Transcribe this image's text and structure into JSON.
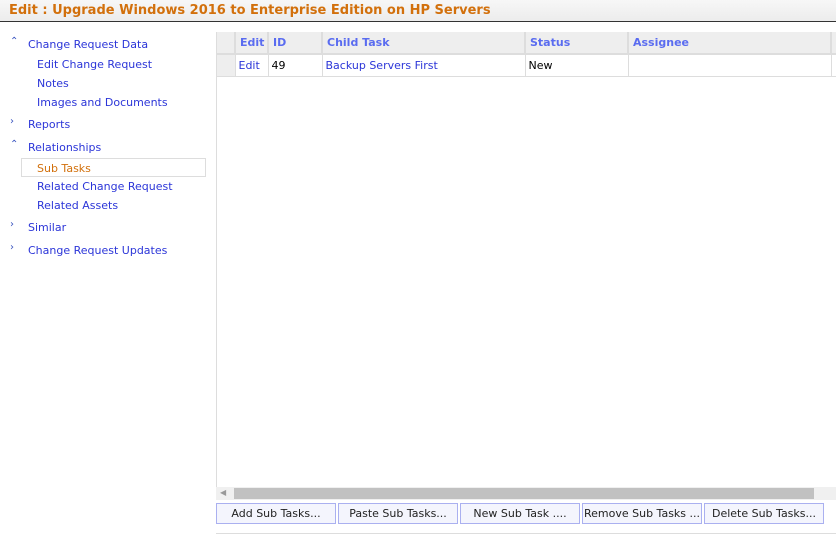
{
  "title": "Edit : Upgrade Windows 2016 to Enterprise Edition on HP Servers",
  "sidebar": {
    "g0": {
      "label": "Change Request Data",
      "icon": "chevron-up-icon",
      "items": [
        "Edit Change Request",
        "Notes",
        "Images and Documents"
      ]
    },
    "g1": {
      "label": "Reports",
      "icon": "chevron-right-icon"
    },
    "g2": {
      "label": "Relationships",
      "icon": "chevron-up-icon",
      "items": [
        "Sub Tasks",
        "Related Change Request",
        "Related Assets"
      ],
      "selected": "Sub Tasks"
    },
    "g3": {
      "label": "Similar",
      "icon": "chevron-right-icon"
    },
    "g4": {
      "label": "Change Request Updates",
      "icon": "chevron-right-icon"
    }
  },
  "grid": {
    "columns": [
      "Edit",
      "ID",
      "Child Task",
      "Status",
      "Assignee",
      ""
    ],
    "rows": [
      {
        "edit": "Edit",
        "id": "49",
        "child_task": "Backup Servers First",
        "status": "New",
        "assignee": ""
      }
    ]
  },
  "buttons": [
    "Add Sub Tasks...",
    "Paste Sub Tasks...",
    "New Sub Task ....",
    "Remove Sub Tasks ...",
    "Delete Sub Tasks..."
  ],
  "colors": {
    "title": "#d2700c",
    "link": "#2b35d8",
    "header": "#5a6cf0"
  }
}
